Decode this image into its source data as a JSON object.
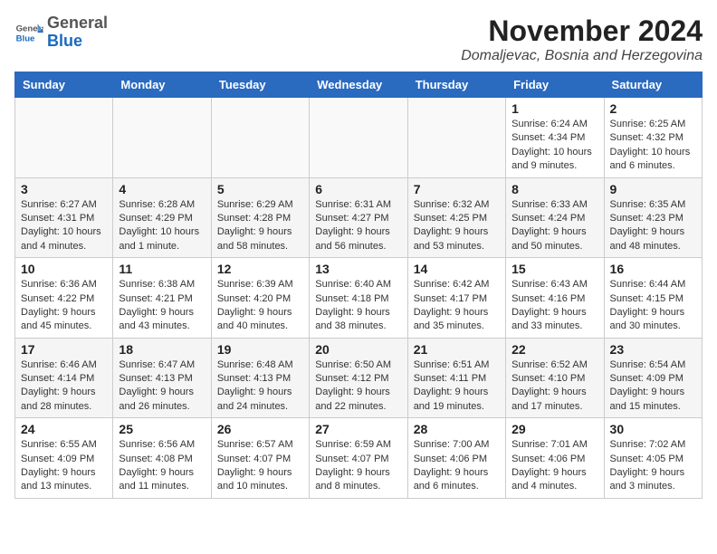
{
  "header": {
    "logo_general": "General",
    "logo_blue": "Blue",
    "month_title": "November 2024",
    "location": "Domaljevac, Bosnia and Herzegovina"
  },
  "columns": [
    "Sunday",
    "Monday",
    "Tuesday",
    "Wednesday",
    "Thursday",
    "Friday",
    "Saturday"
  ],
  "weeks": [
    {
      "days": [
        {
          "num": "",
          "info": "",
          "empty": true
        },
        {
          "num": "",
          "info": "",
          "empty": true
        },
        {
          "num": "",
          "info": "",
          "empty": true
        },
        {
          "num": "",
          "info": "",
          "empty": true
        },
        {
          "num": "",
          "info": "",
          "empty": true
        },
        {
          "num": "1",
          "info": "Sunrise: 6:24 AM\nSunset: 4:34 PM\nDaylight: 10 hours and 9 minutes."
        },
        {
          "num": "2",
          "info": "Sunrise: 6:25 AM\nSunset: 4:32 PM\nDaylight: 10 hours and 6 minutes."
        }
      ]
    },
    {
      "days": [
        {
          "num": "3",
          "info": "Sunrise: 6:27 AM\nSunset: 4:31 PM\nDaylight: 10 hours and 4 minutes."
        },
        {
          "num": "4",
          "info": "Sunrise: 6:28 AM\nSunset: 4:29 PM\nDaylight: 10 hours and 1 minute."
        },
        {
          "num": "5",
          "info": "Sunrise: 6:29 AM\nSunset: 4:28 PM\nDaylight: 9 hours and 58 minutes."
        },
        {
          "num": "6",
          "info": "Sunrise: 6:31 AM\nSunset: 4:27 PM\nDaylight: 9 hours and 56 minutes."
        },
        {
          "num": "7",
          "info": "Sunrise: 6:32 AM\nSunset: 4:25 PM\nDaylight: 9 hours and 53 minutes."
        },
        {
          "num": "8",
          "info": "Sunrise: 6:33 AM\nSunset: 4:24 PM\nDaylight: 9 hours and 50 minutes."
        },
        {
          "num": "9",
          "info": "Sunrise: 6:35 AM\nSunset: 4:23 PM\nDaylight: 9 hours and 48 minutes."
        }
      ]
    },
    {
      "days": [
        {
          "num": "10",
          "info": "Sunrise: 6:36 AM\nSunset: 4:22 PM\nDaylight: 9 hours and 45 minutes."
        },
        {
          "num": "11",
          "info": "Sunrise: 6:38 AM\nSunset: 4:21 PM\nDaylight: 9 hours and 43 minutes."
        },
        {
          "num": "12",
          "info": "Sunrise: 6:39 AM\nSunset: 4:20 PM\nDaylight: 9 hours and 40 minutes."
        },
        {
          "num": "13",
          "info": "Sunrise: 6:40 AM\nSunset: 4:18 PM\nDaylight: 9 hours and 38 minutes."
        },
        {
          "num": "14",
          "info": "Sunrise: 6:42 AM\nSunset: 4:17 PM\nDaylight: 9 hours and 35 minutes."
        },
        {
          "num": "15",
          "info": "Sunrise: 6:43 AM\nSunset: 4:16 PM\nDaylight: 9 hours and 33 minutes."
        },
        {
          "num": "16",
          "info": "Sunrise: 6:44 AM\nSunset: 4:15 PM\nDaylight: 9 hours and 30 minutes."
        }
      ]
    },
    {
      "days": [
        {
          "num": "17",
          "info": "Sunrise: 6:46 AM\nSunset: 4:14 PM\nDaylight: 9 hours and 28 minutes."
        },
        {
          "num": "18",
          "info": "Sunrise: 6:47 AM\nSunset: 4:13 PM\nDaylight: 9 hours and 26 minutes."
        },
        {
          "num": "19",
          "info": "Sunrise: 6:48 AM\nSunset: 4:13 PM\nDaylight: 9 hours and 24 minutes."
        },
        {
          "num": "20",
          "info": "Sunrise: 6:50 AM\nSunset: 4:12 PM\nDaylight: 9 hours and 22 minutes."
        },
        {
          "num": "21",
          "info": "Sunrise: 6:51 AM\nSunset: 4:11 PM\nDaylight: 9 hours and 19 minutes."
        },
        {
          "num": "22",
          "info": "Sunrise: 6:52 AM\nSunset: 4:10 PM\nDaylight: 9 hours and 17 minutes."
        },
        {
          "num": "23",
          "info": "Sunrise: 6:54 AM\nSunset: 4:09 PM\nDaylight: 9 hours and 15 minutes."
        }
      ]
    },
    {
      "days": [
        {
          "num": "24",
          "info": "Sunrise: 6:55 AM\nSunset: 4:09 PM\nDaylight: 9 hours and 13 minutes."
        },
        {
          "num": "25",
          "info": "Sunrise: 6:56 AM\nSunset: 4:08 PM\nDaylight: 9 hours and 11 minutes."
        },
        {
          "num": "26",
          "info": "Sunrise: 6:57 AM\nSunset: 4:07 PM\nDaylight: 9 hours and 10 minutes."
        },
        {
          "num": "27",
          "info": "Sunrise: 6:59 AM\nSunset: 4:07 PM\nDaylight: 9 hours and 8 minutes."
        },
        {
          "num": "28",
          "info": "Sunrise: 7:00 AM\nSunset: 4:06 PM\nDaylight: 9 hours and 6 minutes."
        },
        {
          "num": "29",
          "info": "Sunrise: 7:01 AM\nSunset: 4:06 PM\nDaylight: 9 hours and 4 minutes."
        },
        {
          "num": "30",
          "info": "Sunrise: 7:02 AM\nSunset: 4:05 PM\nDaylight: 9 hours and 3 minutes."
        }
      ]
    }
  ]
}
